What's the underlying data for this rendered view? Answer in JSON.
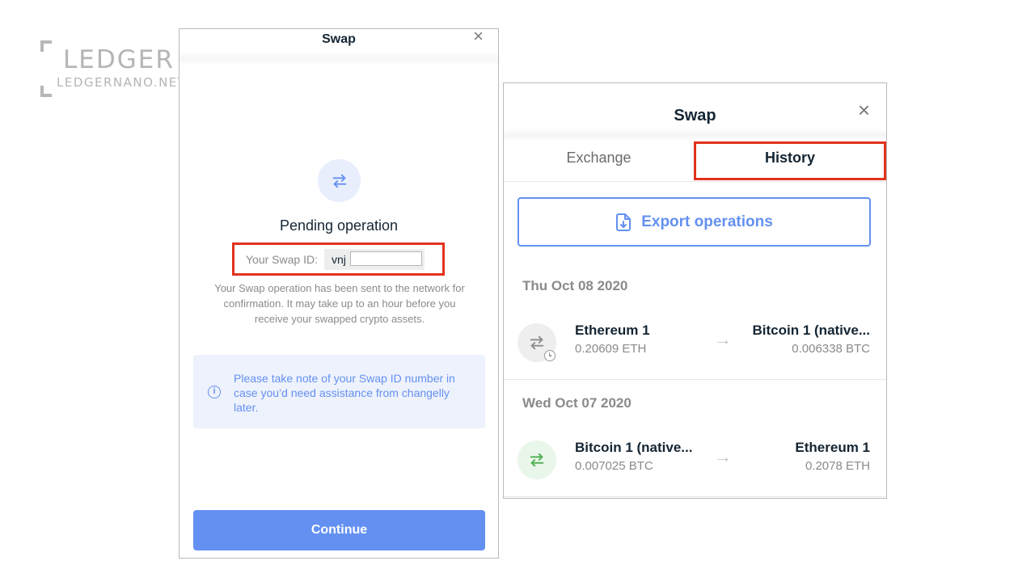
{
  "watermark": {
    "brand": "LEDGER",
    "site": "LEDGERNANO.NET"
  },
  "left_panel": {
    "title": "Swap",
    "close_icon": "×",
    "icon": "swap-arrows-icon",
    "heading": "Pending operation",
    "swap_id_label": "Your Swap ID:",
    "swap_id_value": "vnj",
    "description": "Your Swap operation has been sent to the network for confirmation. It may take up to an hour before you receive your swapped crypto assets.",
    "info_text": "Please take note of your Swap ID number in case you’d need assistance from changelly later.",
    "continue_label": "Continue",
    "accent_color": "#6490f1",
    "highlight_color": "#e1321c"
  },
  "right_panel": {
    "title": "Swap",
    "close_icon": "×",
    "tabs": [
      {
        "label": "Exchange",
        "active": false
      },
      {
        "label": "History",
        "active": true
      }
    ],
    "export_label": "Export operations",
    "groups": [
      {
        "date": "Thu Oct 08 2020",
        "operations": [
          {
            "status": "pending",
            "from_name": "Ethereum 1",
            "from_amount": "0.20609 ETH",
            "to_name": "Bitcoin 1 (native...",
            "to_amount": "0.006338 BTC"
          }
        ]
      },
      {
        "date": "Wed Oct 07 2020",
        "operations": [
          {
            "status": "finished",
            "from_name": "Bitcoin 1 (native...",
            "from_amount": "0.007025 BTC",
            "to_name": "Ethereum 1",
            "to_amount": "0.2078 ETH"
          }
        ]
      }
    ]
  }
}
